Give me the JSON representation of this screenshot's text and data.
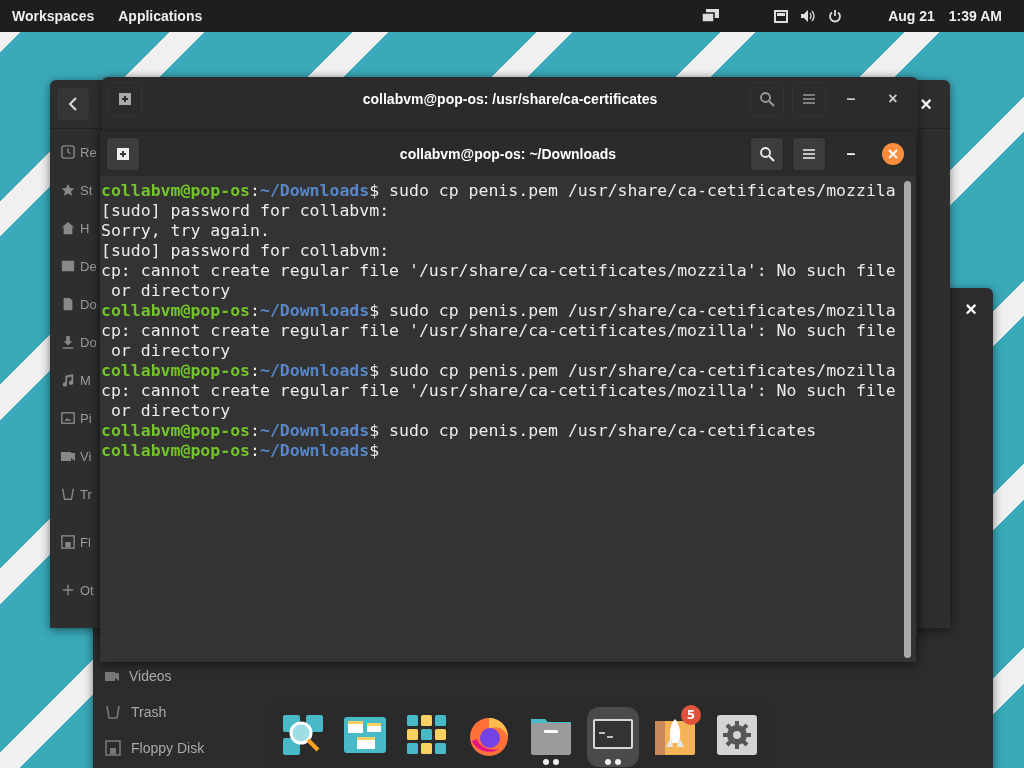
{
  "top_bar": {
    "menus": [
      "Workspaces",
      "Applications"
    ],
    "date": "Aug 21",
    "time": "1:39 AM"
  },
  "back_window": {
    "sidebar": [
      "Videos",
      "Trash",
      "Floppy Disk"
    ],
    "close": "×"
  },
  "file_manager": {
    "close": "×",
    "sidebar": [
      "Re",
      "St",
      "H",
      "De",
      "Do",
      "Do",
      "M",
      "Pi",
      "Vi",
      "Tr",
      "Fl",
      "Ot"
    ]
  },
  "terminal_back": {
    "title": "collabvm@pop-os: /usr/share/ca-certificates",
    "close": "×",
    "minimize": "–"
  },
  "terminal": {
    "title": "collabvm@pop-os: ~/Downloads",
    "minimize": "–",
    "lines": [
      {
        "kind": "prompt",
        "user": "collabvm@pop-os",
        "sep": ":",
        "path": "~/Downloads",
        "command": "$ sudo cp penis.pem /usr/share/ca-cetificates/mozzila"
      },
      {
        "kind": "output",
        "text": "[sudo] password for collabvm:"
      },
      {
        "kind": "output",
        "text": "Sorry, try again."
      },
      {
        "kind": "output",
        "text": "[sudo] password for collabvm:"
      },
      {
        "kind": "output",
        "text": "cp: cannot create regular file '/usr/share/ca-cetificates/mozzila': No such file"
      },
      {
        "kind": "output",
        "text": " or directory"
      },
      {
        "kind": "prompt",
        "user": "collabvm@pop-os",
        "sep": ":",
        "path": "~/Downloads",
        "command": "$ sudo cp penis.pem /usr/share/ca-cetificates/mozilla"
      },
      {
        "kind": "output",
        "text": "cp: cannot create regular file '/usr/share/ca-cetificates/mozilla': No such file"
      },
      {
        "kind": "output",
        "text": " or directory"
      },
      {
        "kind": "prompt",
        "user": "collabvm@pop-os",
        "sep": ":",
        "path": "~/Downloads",
        "command": "$ sudo cp penis.pem /usr/share/ca-cetificates/mozilla"
      },
      {
        "kind": "output",
        "text": "cp: cannot create regular file '/usr/share/ca-cetificates/mozilla': No such file"
      },
      {
        "kind": "output",
        "text": " or directory"
      },
      {
        "kind": "prompt",
        "user": "collabvm@pop-os",
        "sep": ":",
        "path": "~/Downloads",
        "command": "$ sudo cp penis.pem /usr/share/ca-cetificates"
      },
      {
        "kind": "prompt",
        "user": "collabvm@pop-os",
        "sep": ":",
        "path": "~/Downloads",
        "command": "$"
      }
    ]
  },
  "dock": [
    {
      "running": false,
      "selected": false
    },
    {
      "running": false,
      "selected": false
    },
    {
      "running": false,
      "selected": false
    },
    {
      "running": false,
      "selected": false
    },
    {
      "running": true,
      "selected": false
    },
    {
      "running": true,
      "selected": true
    },
    {
      "running": false,
      "selected": false,
      "badge": "5"
    },
    {
      "running": false,
      "selected": false
    }
  ]
}
